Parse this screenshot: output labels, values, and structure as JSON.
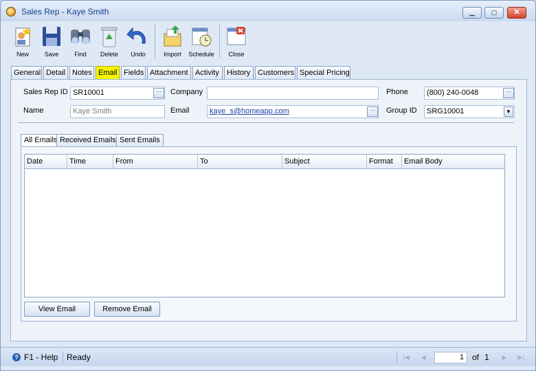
{
  "window": {
    "title": "Sales Rep - Kaye Smith"
  },
  "toolbar": {
    "buttons": [
      {
        "label": "New",
        "icon": "new-icon"
      },
      {
        "label": "Save",
        "icon": "save-icon"
      },
      {
        "label": "Find",
        "icon": "find-icon"
      },
      {
        "label": "Delete",
        "icon": "delete-icon"
      },
      {
        "label": "Undo",
        "icon": "undo-icon"
      },
      {
        "label": "Import",
        "icon": "import-icon"
      },
      {
        "label": "Schedule",
        "icon": "schedule-icon"
      },
      {
        "label": "Close",
        "icon": "close-icon"
      }
    ]
  },
  "tabs": [
    "General",
    "Detail",
    "Notes",
    "Email",
    "Fields",
    "Attachment",
    "Activity",
    "History",
    "Customers",
    "Special Pricing"
  ],
  "active_tab": "Email",
  "form": {
    "sales_rep_id_label": "Sales Rep ID",
    "sales_rep_id": "SR10001",
    "company_label": "Company",
    "company": "",
    "phone_label": "Phone",
    "phone": "(800) 240-0048",
    "name_label": "Name",
    "name": "Kaye Smith",
    "email_label": "Email",
    "email": "kaye_s@homeapp.com",
    "group_id_label": "Group ID",
    "group_id": "SRG10001"
  },
  "email_tabs": [
    "All Emails",
    "Received Emails",
    "Sent Emails"
  ],
  "grid": {
    "columns": [
      "Date",
      "Time",
      "From",
      "To",
      "Subject",
      "Format",
      "Email Body"
    ],
    "rows": []
  },
  "actions": {
    "view_email": "View Email",
    "remove_email": "Remove Email"
  },
  "status": {
    "help": "F1 - Help",
    "state": "Ready",
    "page": "1",
    "of_label": "of",
    "total_pages": "1"
  },
  "colors": {
    "active_tab": "#f5f500",
    "title_text": "#15428b"
  }
}
